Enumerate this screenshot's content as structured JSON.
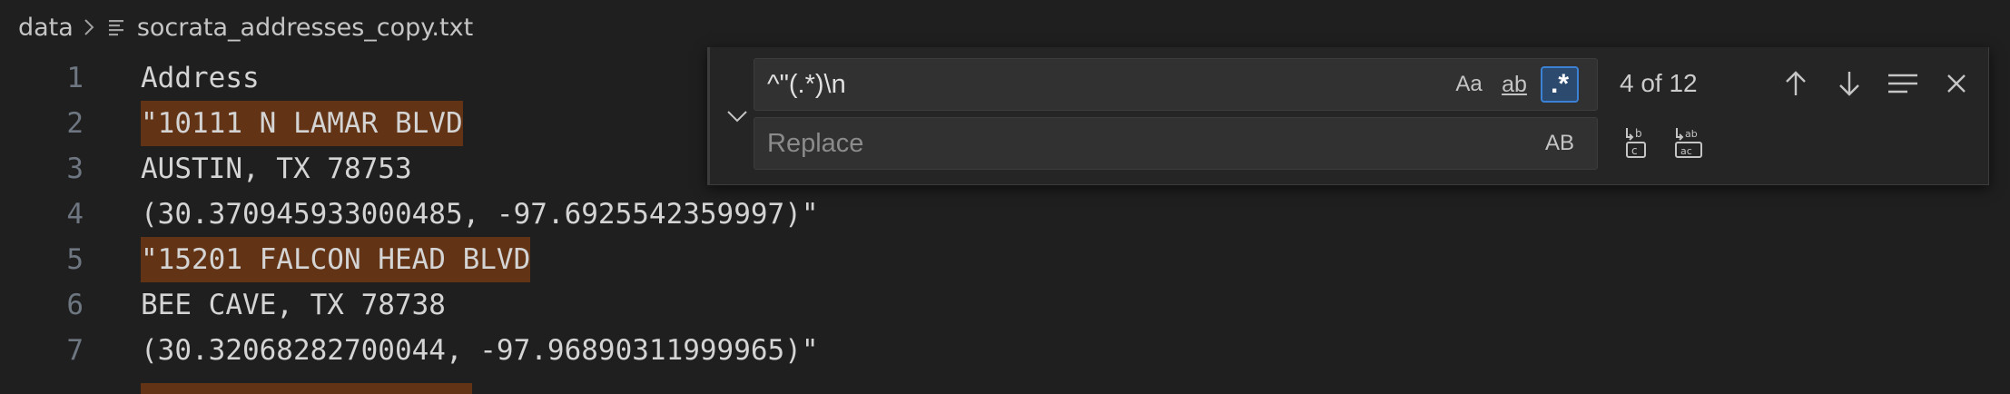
{
  "breadcrumb": {
    "folder": "data",
    "file": "socrata_addresses_copy.txt"
  },
  "editor": {
    "lines": [
      {
        "num": "1",
        "text": "Address",
        "highlight": false
      },
      {
        "num": "2",
        "text": "\"10111 N LAMAR BLVD",
        "highlight": true
      },
      {
        "num": "3",
        "text": "AUSTIN, TX 78753",
        "highlight": false
      },
      {
        "num": "4",
        "text": "(30.370945933000485, -97.6925542359997)\"",
        "highlight": false
      },
      {
        "num": "5",
        "text": "\"15201 FALCON HEAD BLVD",
        "highlight": true
      },
      {
        "num": "6",
        "text": "BEE CAVE, TX 78738",
        "highlight": false
      },
      {
        "num": "7",
        "text": "(30.32068282700044, -97.96890311999965)\"",
        "highlight": false
      }
    ]
  },
  "find_widget": {
    "find_value": "^\"(.*)\\n",
    "replace_placeholder": "Replace",
    "match_case_label": "Aa",
    "whole_word_label": "ab",
    "regex_label": ".*",
    "preserve_case_label": "AB",
    "match_count": "4 of 12"
  },
  "colors": {
    "match_highlight": "#623315",
    "active_toggle": "#2b4a6e",
    "background": "#1f1f1f"
  }
}
